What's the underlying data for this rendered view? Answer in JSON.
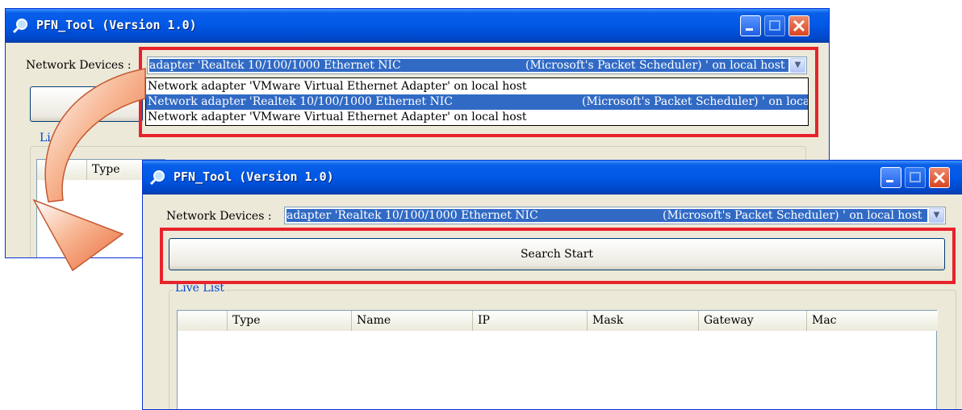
{
  "top_window": {
    "title": "PFN_Tool (Version 1.0)",
    "network_label": "Network Devices :",
    "combo_selected_left": "adapter 'Realtek 10/100/1000 Ethernet NIC",
    "combo_selected_right": "(Microsoft's Packet Scheduler) ' on local host",
    "dropdown_options": [
      {
        "left": "Network adapter 'VMware Virtual Ethernet Adapter' on local host",
        "right": ""
      },
      {
        "left": "Network adapter 'Realtek 10/100/1000 Ethernet NIC",
        "right": "(Microsoft's Packet Scheduler) ' on loca"
      },
      {
        "left": "Network adapter 'VMware Virtual Ethernet Adapter' on local host",
        "right": ""
      }
    ],
    "group_label_partial": "Li",
    "group_label_partial2": "t",
    "column_partial": "Type"
  },
  "bottom_window": {
    "title": "PFN_Tool (Version 1.0)",
    "network_label": "Network Devices :",
    "combo_selected_left": "adapter 'Realtek 10/100/1000 Ethernet NIC",
    "combo_selected_right": "(Microsoft's Packet Scheduler) ' on local host",
    "search_button": "Search Start",
    "group_label": "Live List",
    "columns": [
      "",
      "Type",
      "Name",
      "IP",
      "Mask",
      "Gateway",
      "Mac"
    ]
  },
  "colors": {
    "highlight": "#e8222b",
    "arrow_fill": "#f07a4a",
    "selection": "#316ac5"
  }
}
